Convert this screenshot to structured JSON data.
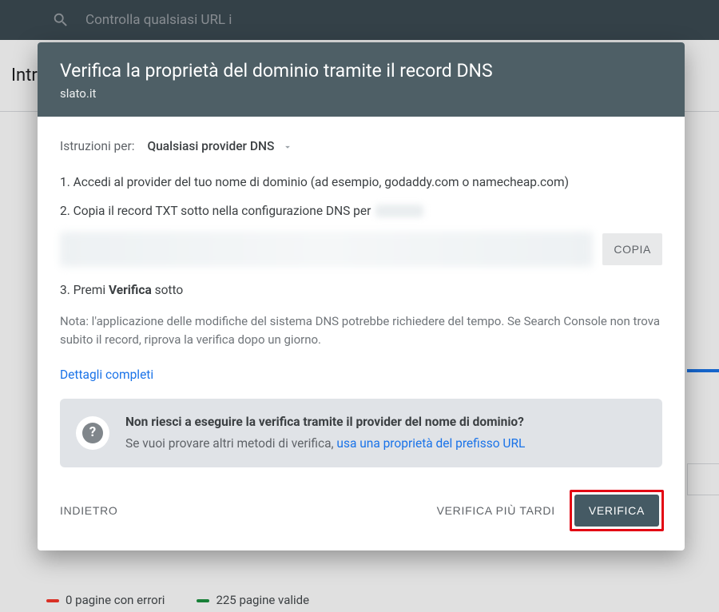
{
  "background": {
    "search_placeholder": "Controlla qualsiasi URL i",
    "page_header": "Intr",
    "stats": {
      "errors": "0 pagine con errori",
      "valid": "225 pagine valide"
    }
  },
  "dialog": {
    "title": "Verifica la proprietà del dominio tramite il record DNS",
    "subtitle": "slato.it",
    "instructions_label": "Istruzioni per:",
    "provider_selected": "Qualsiasi provider DNS",
    "step1": "1. Accedi al provider del tuo nome di dominio (ad esempio, godaddy.com o namecheap.com)",
    "step2_prefix": "2. Copia il record TXT sotto nella configurazione DNS per",
    "copy_label": "COPIA",
    "step3_prefix": "3. Premi ",
    "step3_bold": "Verifica",
    "step3_suffix": " sotto",
    "note": "Nota: l'applicazione delle modifiche del sistema DNS potrebbe richiedere del tempo. Se Search Console non trova subito il record, riprova la verifica dopo un giorno.",
    "details_link": "Dettagli completi",
    "info": {
      "title": "Non riesci a eseguire la verifica tramite il provider del nome di dominio?",
      "subtitle_prefix": "Se vuoi provare altri metodi di verifica, ",
      "subtitle_link": "usa una proprietà del prefisso URL"
    },
    "buttons": {
      "back": "INDIETRO",
      "later": "VERIFICA PIÙ TARDI",
      "verify": "VERIFICA"
    }
  }
}
